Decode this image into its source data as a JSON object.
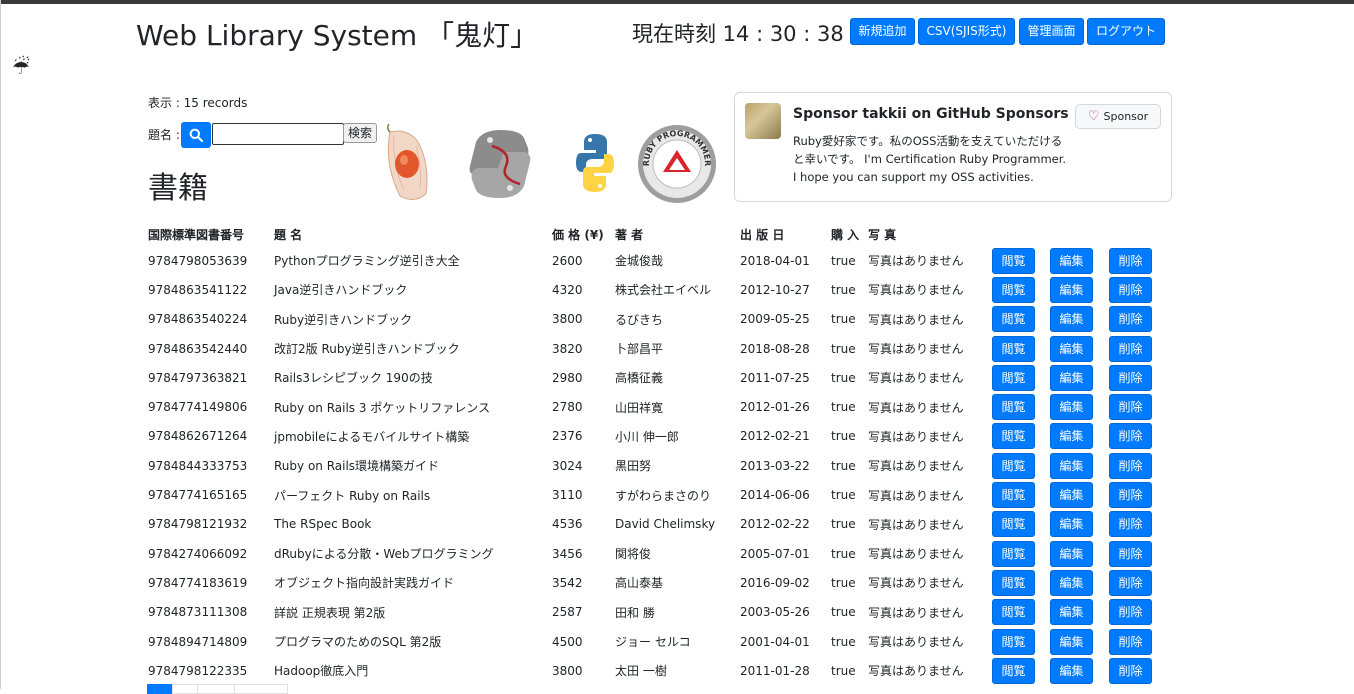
{
  "header": {
    "app_title": "Web Library System 「鬼灯」",
    "clock": "現在時刻 14 : 30 : 38",
    "nav": [
      {
        "label": "新規追加"
      },
      {
        "label": "CSV(SJIS形式)"
      },
      {
        "label": "管理画面"
      },
      {
        "label": "ログアウト"
      }
    ]
  },
  "search": {
    "records": "表示 : 15 records",
    "label": "題名 :",
    "value": "",
    "submit": "検索"
  },
  "section_title": "書籍",
  "sponsor": {
    "title": "Sponsor takkii on GitHub Sponsors",
    "button": "Sponsor",
    "description": "Ruby愛好家です。私のOSS活動を支えていただけると幸いです。 I'm Certification Ruby Programmer. I hope you can support my OSS activities.",
    "badge_text": "RUBY PROGRAMMER"
  },
  "table": {
    "headers": [
      "国際標準図書番号",
      "題 名",
      "価 格 (¥)",
      "著 者",
      "出 版 日",
      "購 入",
      "写 真"
    ],
    "actions": [
      "閲覧",
      "編集",
      "削除"
    ],
    "rows": [
      [
        "9784798053639",
        "Pythonプログラミング逆引き大全",
        "2600",
        "金城俊哉",
        "2018-04-01",
        "true",
        "写真はありません"
      ],
      [
        "9784863541122",
        "Java逆引きハンドブック",
        "4320",
        "株式会社エイベル",
        "2012-10-27",
        "true",
        "写真はありません"
      ],
      [
        "9784863540224",
        "Ruby逆引きハンドブック",
        "3800",
        "るびきち",
        "2009-05-25",
        "true",
        "写真はありません"
      ],
      [
        "9784863542440",
        "改訂2版 Ruby逆引きハンドブック",
        "3820",
        "卜部昌平",
        "2018-08-28",
        "true",
        "写真はありません"
      ],
      [
        "9784797363821",
        "Rails3レシピブック 190の技",
        "2980",
        "高橋征義",
        "2011-07-25",
        "true",
        "写真はありません"
      ],
      [
        "9784774149806",
        "Ruby on Rails 3 ポケットリファレンス",
        "2780",
        "山田祥寛",
        "2012-01-26",
        "true",
        "写真はありません"
      ],
      [
        "9784862671264",
        "jpmobileによるモバイルサイト構築",
        "2376",
        "小川 伸一郎",
        "2012-02-21",
        "true",
        "写真はありません"
      ],
      [
        "9784844333753",
        "Ruby on Rails環境構築ガイド",
        "3024",
        "黒田努",
        "2013-03-22",
        "true",
        "写真はありません"
      ],
      [
        "9784774165165",
        "パーフェクト Ruby on Rails",
        "3110",
        "すがわらまさのり",
        "2014-06-06",
        "true",
        "写真はありません"
      ],
      [
        "9784798121932",
        "The RSpec Book",
        "4536",
        "David Chelimsky",
        "2012-02-22",
        "true",
        "写真はありません"
      ],
      [
        "9784274066092",
        "dRubyによる分散・Webプログラミング",
        "3456",
        "関将俊",
        "2005-07-01",
        "true",
        "写真はありません"
      ],
      [
        "9784774183619",
        "オブジェクト指向設計実践ガイド",
        "3542",
        "高山泰基",
        "2016-09-02",
        "true",
        "写真はありません"
      ],
      [
        "9784873111308",
        "詳説 正規表現 第2版",
        "2587",
        "田和 勝",
        "2003-05-26",
        "true",
        "写真はありません"
      ],
      [
        "9784894714809",
        "プログラマのためのSQL 第2版",
        "4500",
        "ジョー セルコ",
        "2001-04-01",
        "true",
        "写真はありません"
      ],
      [
        "9784798122335",
        "Hadoop徹底入門",
        "3800",
        "太田 一樹",
        "2011-01-28",
        "true",
        "写真はありません"
      ]
    ]
  },
  "colors": {
    "primary": "#007bff",
    "sponsor_heart": "#bf3989"
  }
}
